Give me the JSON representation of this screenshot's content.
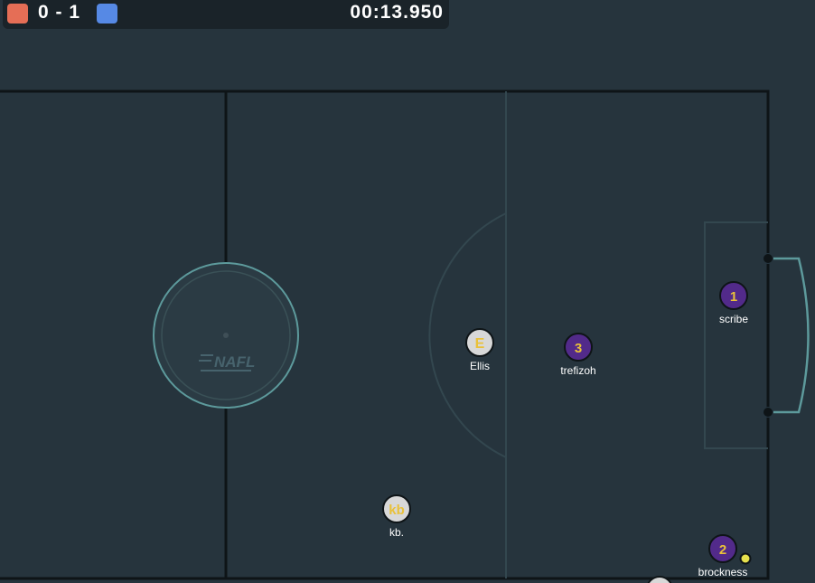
{
  "scoreboard": {
    "score_text": "0 - 1",
    "timer": "00:13.950",
    "red_color": "#e56e56",
    "blue_color": "#5689e5"
  },
  "colors": {
    "background": "#26343d",
    "line": "#0e1417",
    "accent_line": "#5d9a9c",
    "red_team_player": "#d8d8d8",
    "blue_team_player": "#522a8a",
    "avatar_text": "#e9c13a",
    "ball": "#e6e14d"
  },
  "field": {
    "logo_text": "NAFL"
  },
  "players": [
    {
      "id": "ellis",
      "team": "red",
      "avatar": "E",
      "name": "Ellis"
    },
    {
      "id": "kb",
      "team": "red",
      "avatar": "kb",
      "name": "kb."
    },
    {
      "id": "trefizoh",
      "team": "blue",
      "avatar": "3",
      "name": "trefizoh"
    },
    {
      "id": "scribe",
      "team": "blue",
      "avatar": "1",
      "name": "scribe"
    },
    {
      "id": "brockness",
      "team": "blue",
      "avatar": "2",
      "name": "brockness"
    }
  ]
}
